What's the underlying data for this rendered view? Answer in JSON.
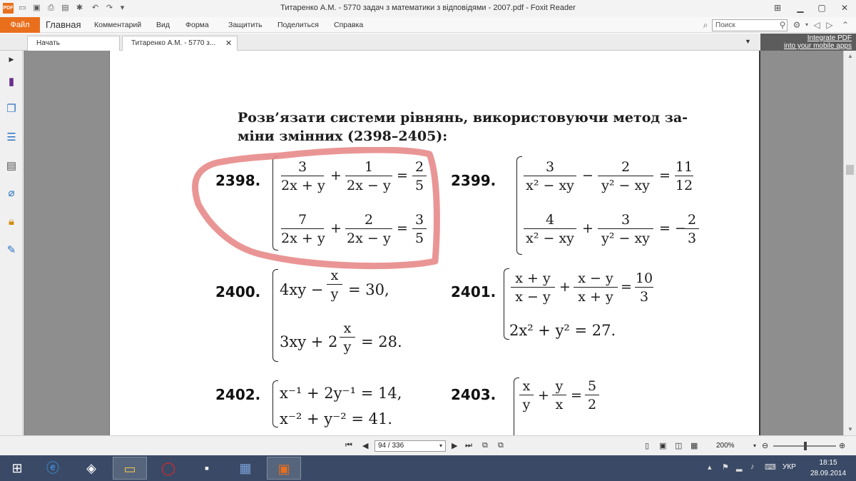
{
  "window": {
    "title": "Титаренко А.М. - 5770 задач з математики з відповідями - 2007.pdf - Foxit Reader",
    "logo_text": "PDF"
  },
  "ribbon": {
    "file": "Файл",
    "tabs": [
      "Главная",
      "Комментарий",
      "Вид",
      "Форма",
      "Защитить",
      "Поделиться",
      "Справка"
    ],
    "search_placeholder": "Поиск"
  },
  "doc_tabs": {
    "start": "Начать",
    "current": "Титаренко А.М. - 5770 з...",
    "promo_line1": "Integrate PDF",
    "promo_line2": "into your mobile apps"
  },
  "document": {
    "heading_line1": "Розв’язати системи рівнянь, використовуючи метод за-",
    "heading_line2": "міни змінних (2398–2405):",
    "problems": [
      {
        "number": "2398."
      },
      {
        "number": "2399."
      },
      {
        "number": "2400."
      },
      {
        "number": "2401."
      },
      {
        "number": "2402."
      },
      {
        "number": "2403."
      }
    ],
    "p2398": {
      "r1": {
        "f1n": "3",
        "f1d": "2х + у",
        "f2n": "1",
        "f2d": "2х − у",
        "rn": "2",
        "rd": "5"
      },
      "r2": {
        "f1n": "7",
        "f1d": "2х + у",
        "f2n": "2",
        "f2d": "2х − у",
        "rn": "3",
        "rd": "5"
      }
    },
    "p2399": {
      "r1": {
        "f1n": "3",
        "f1d": "x² − xy",
        "f2n": "2",
        "f2d": "y² − xy",
        "rn": "11",
        "rd": "12"
      },
      "r2": {
        "f1n": "4",
        "f1d": "x² − xy",
        "f2n": "3",
        "f2d": "y² − xy",
        "rn": "2",
        "rd": "3"
      }
    },
    "p2400": {
      "r1_left": "4xy −",
      "fn": "x",
      "fd": "y",
      "r1_right": "= 30,",
      "r2_left": "3xy + 2",
      "r2_right": "= 28."
    },
    "p2401": {
      "f1n": "x + y",
      "f1d": "x − y",
      "f2n": "x − y",
      "f2d": "x + y",
      "rn": "10",
      "rd": "3",
      "r2": "2x² + y² = 27."
    },
    "p2402": {
      "r1": "x⁻¹ + 2y⁻¹ = 14,",
      "r2": "x⁻² + y⁻² = 41."
    },
    "p2403": {
      "f1n": "x",
      "f1d": "y",
      "f2n": "y",
      "f2d": "x",
      "rn": "5",
      "rd": "2"
    }
  },
  "statusbar": {
    "page": "94 / 336",
    "zoom": "200%"
  },
  "taskbar": {
    "lang": "УКР",
    "time": "18:15",
    "date": "28.09.2014"
  },
  "colors": {
    "accent": "#e96f1d",
    "highlight": "#e88a8a",
    "taskbar": "#3a4a66"
  }
}
